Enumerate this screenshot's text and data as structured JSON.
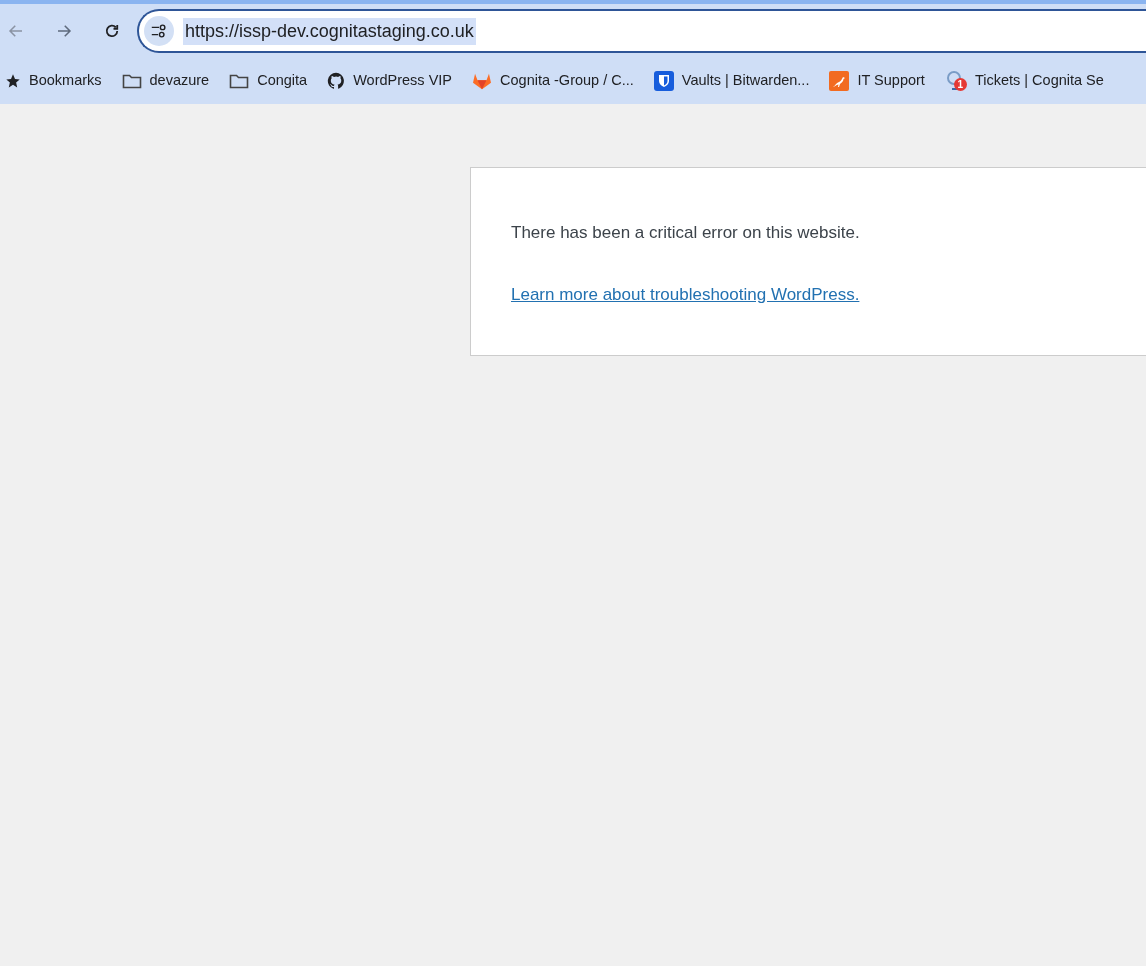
{
  "toolbar": {
    "back_disabled": true,
    "forward_disabled": true
  },
  "address_bar": {
    "url": "https://issp-dev.cognitastaging.co.uk",
    "selected": true
  },
  "bookmarks": [
    {
      "kind": "star",
      "label": "Bookmarks"
    },
    {
      "kind": "folder",
      "label": "devazure"
    },
    {
      "kind": "folder",
      "label": "Congita"
    },
    {
      "kind": "github",
      "label": "WordPress VIP"
    },
    {
      "kind": "gitlab",
      "label": "Cognita -Group / C..."
    },
    {
      "kind": "shield",
      "label": "Vaults | Bitwarden..."
    },
    {
      "kind": "kangaroo",
      "label": "IT Support"
    },
    {
      "kind": "tickets",
      "label": "Tickets | Cognita Se",
      "badge": "1"
    }
  ],
  "error_card": {
    "message": "There has been a critical error on this website.",
    "link": "Learn more about troubleshooting WordPress."
  }
}
